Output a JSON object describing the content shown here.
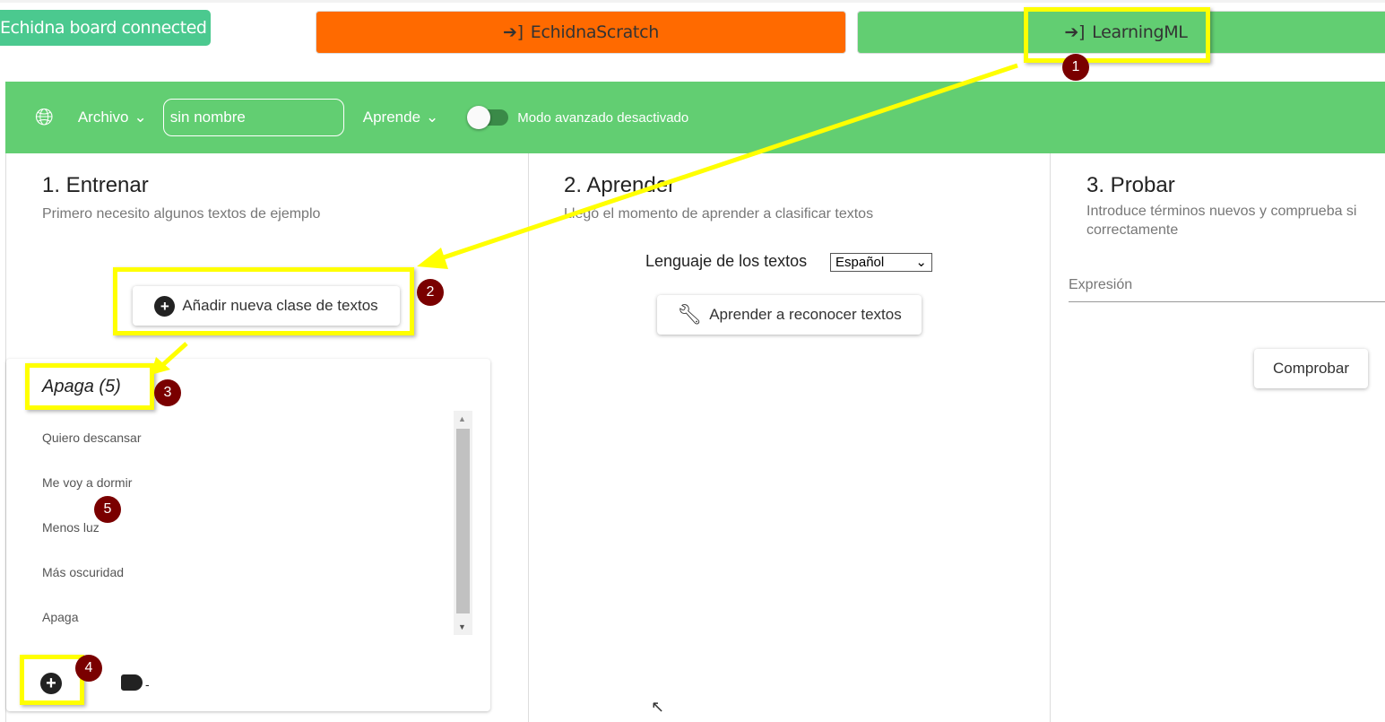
{
  "header": {
    "board_status": "Echidna board connected",
    "echidna_scratch": "EchidnaScratch",
    "learningml": "LearningML"
  },
  "nav": {
    "archivo": "Archivo",
    "project_name": "sin nombre",
    "aprende": "Aprende",
    "mode_label": "Modo avanzado desactivado",
    "mode_on": false
  },
  "train": {
    "title": "1. Entrenar",
    "subtitle": "Primero necesito algunos textos de ejemplo",
    "add_class": "Añadir nueva clase de textos",
    "class_title": "Apaga (5)",
    "examples": [
      "Quiero descansar",
      "Me voy a dormir",
      "Menos luz",
      "Más oscuridad",
      "Apaga"
    ],
    "tag_label": "-"
  },
  "learn": {
    "title": "2. Aprender",
    "subtitle": "Llegó el momento de aprender a clasificar textos",
    "language_label": "Lenguaje de los textos",
    "language": "Español",
    "learn_button": "Aprender a reconocer textos"
  },
  "test": {
    "title": "3. Probar",
    "subtitle": "Introduce términos nuevos y comprueba si",
    "subtitle2": "correctamente",
    "expression_placeholder": "Expresión",
    "check_button": "Comprobar"
  },
  "annotations": [
    "1",
    "2",
    "3",
    "4",
    "5"
  ],
  "colors": {
    "echidna": "#ff6a00",
    "learningml": "#62ce72",
    "board": "#4bc98f",
    "highlight": "#ffff00",
    "badge": "#7a0000"
  }
}
